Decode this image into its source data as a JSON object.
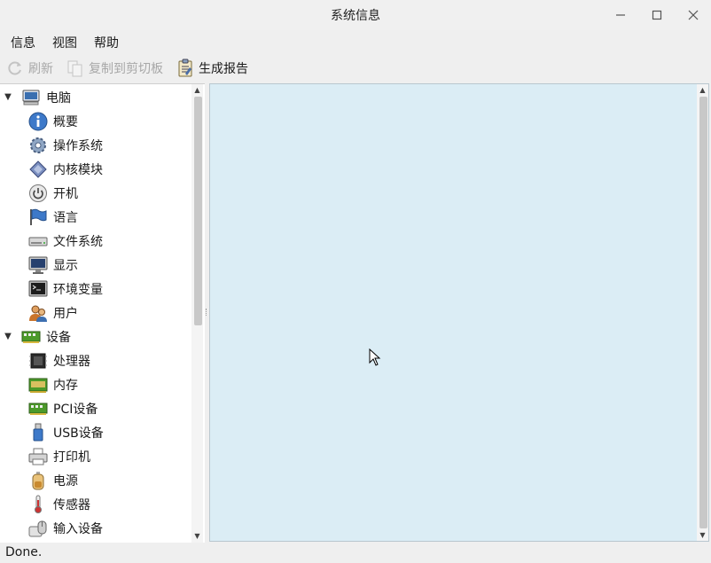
{
  "window": {
    "title": "系统信息"
  },
  "menubar": {
    "items": [
      "信息",
      "视图",
      "帮助"
    ]
  },
  "toolbar": {
    "refresh_label": "刷新",
    "copy_label": "复制到剪切板",
    "report_label": "生成报告"
  },
  "tree": {
    "computer": {
      "label": "电脑",
      "children": [
        "概要",
        "操作系统",
        "内核模块",
        "开机",
        "语言",
        "文件系统",
        "显示",
        "环境变量",
        "用户"
      ]
    },
    "devices": {
      "label": "设备",
      "children": [
        "处理器",
        "内存",
        "PCI设备",
        "USB设备",
        "打印机",
        "电源",
        "传感器",
        "输入设备"
      ]
    }
  },
  "statusbar": {
    "text": "Done."
  },
  "colors": {
    "content_bg": "#dbedf5",
    "tree_bg": "#ffffff"
  }
}
